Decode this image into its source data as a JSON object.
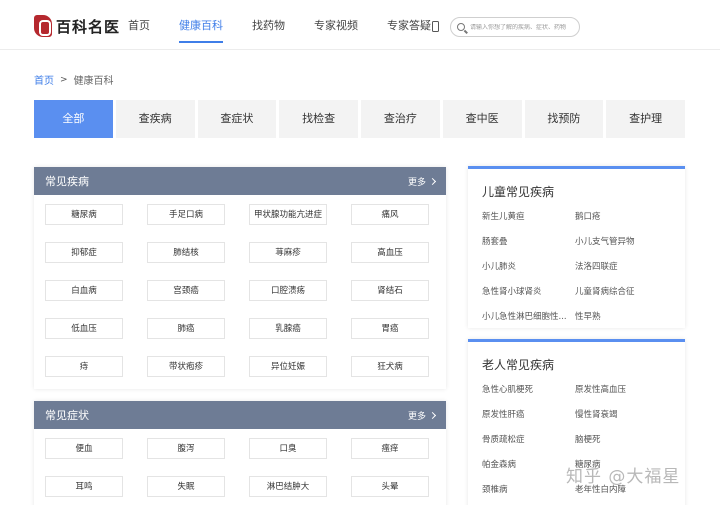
{
  "header": {
    "logo_text": "百科名医",
    "nav": [
      "首页",
      "健康百科",
      "找药物",
      "专家视频",
      "专家答疑"
    ],
    "search_placeholder": "请输入你想了解的疾病、症状、药物"
  },
  "breadcrumb": {
    "home": "首页",
    "current": "健康百科"
  },
  "tabs": [
    "全部",
    "查疾病",
    "查症状",
    "找检查",
    "查治疗",
    "查中医",
    "找预防",
    "查护理"
  ],
  "common_diseases": {
    "title": "常见疾病",
    "more": "更多",
    "items": [
      "糖尿病",
      "手足口病",
      "甲状腺功能亢进症",
      "痛风",
      "抑郁症",
      "肺结核",
      "荨麻疹",
      "高血压",
      "白血病",
      "宫颈癌",
      "口腔溃疡",
      "肾结石",
      "低血压",
      "肺癌",
      "乳腺癌",
      "胃癌",
      "痔",
      "带状疱疹",
      "异位妊娠",
      "狂犬病"
    ]
  },
  "common_symptoms": {
    "title": "常见症状",
    "more": "更多",
    "items": [
      "便血",
      "腹泻",
      "口臭",
      "瘙痒",
      "耳鸣",
      "失眠",
      "淋巴结肿大",
      "头晕"
    ]
  },
  "children_diseases": {
    "title": "儿童常见疾病",
    "items": [
      "新生儿黄疸",
      "鹅口疮",
      "肠套叠",
      "小儿支气管异物",
      "小儿肺炎",
      "法洛四联症",
      "急性肾小球肾炎",
      "儿童肾病综合征",
      "小儿急性淋巴细胞性...",
      "性早熟"
    ]
  },
  "elderly_diseases": {
    "title": "老人常见疾病",
    "items": [
      "急性心肌梗死",
      "原发性高血压",
      "原发性肝癌",
      "慢性肾衰竭",
      "骨质疏松症",
      "脑梗死",
      "帕金森病",
      "糖尿病",
      "颈椎病",
      "老年性白内障"
    ]
  },
  "watermark": "知乎 @大福星"
}
